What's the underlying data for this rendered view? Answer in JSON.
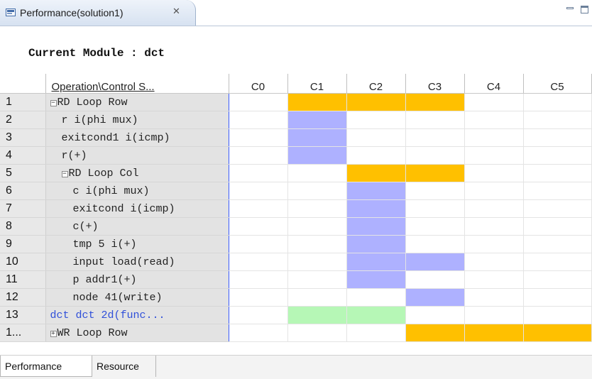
{
  "editor_tab": {
    "title": "Performance(solution1)",
    "close_glyph": "✕",
    "icon": "performance-view-icon"
  },
  "window_controls": {
    "minimize": "minimize-icon",
    "maximize": "maximize-icon"
  },
  "module_heading": "Current Module : dct",
  "table": {
    "headers": {
      "operation": "Operation\\Control S...",
      "steps": [
        "C0",
        "C1",
        "C2",
        "C3",
        "C4",
        "C5"
      ]
    },
    "rows": [
      {
        "num": "1",
        "label": "RD Loop Row",
        "indent": 0,
        "expander": "minus",
        "call": false,
        "cells": [
          "",
          "orange",
          "orange",
          "orange",
          "",
          ""
        ]
      },
      {
        "num": "2",
        "label": "r i(phi mux)",
        "indent": 1,
        "expander": "",
        "call": false,
        "cells": [
          "",
          "blue",
          "",
          "",
          "",
          ""
        ]
      },
      {
        "num": "3",
        "label": "exitcond1 i(icmp)",
        "indent": 1,
        "expander": "",
        "call": false,
        "cells": [
          "",
          "blue",
          "",
          "",
          "",
          ""
        ]
      },
      {
        "num": "4",
        "label": "r(+)",
        "indent": 1,
        "expander": "",
        "call": false,
        "cells": [
          "",
          "blue",
          "",
          "",
          "",
          ""
        ]
      },
      {
        "num": "5",
        "label": "RD Loop Col",
        "indent": 1,
        "expander": "minus",
        "call": false,
        "cells": [
          "",
          "",
          "orange",
          "orange",
          "",
          ""
        ]
      },
      {
        "num": "6",
        "label": "c i(phi mux)",
        "indent": 2,
        "expander": "",
        "call": false,
        "cells": [
          "",
          "",
          "blue",
          "",
          "",
          ""
        ]
      },
      {
        "num": "7",
        "label": "exitcond i(icmp)",
        "indent": 2,
        "expander": "",
        "call": false,
        "cells": [
          "",
          "",
          "blue",
          "",
          "",
          ""
        ]
      },
      {
        "num": "8",
        "label": "c(+)",
        "indent": 2,
        "expander": "",
        "call": false,
        "cells": [
          "",
          "",
          "blue",
          "",
          "",
          ""
        ]
      },
      {
        "num": "9",
        "label": "tmp 5 i(+)",
        "indent": 2,
        "expander": "",
        "call": false,
        "cells": [
          "",
          "",
          "blue",
          "",
          "",
          ""
        ]
      },
      {
        "num": "10",
        "label": "input load(read)",
        "indent": 2,
        "expander": "",
        "call": false,
        "cells": [
          "",
          "",
          "blue",
          "blue",
          "",
          ""
        ]
      },
      {
        "num": "11",
        "label": "p addr1(+)",
        "indent": 2,
        "expander": "",
        "call": false,
        "cells": [
          "",
          "",
          "blue",
          "",
          "",
          ""
        ]
      },
      {
        "num": "12",
        "label": "node 41(write)",
        "indent": 2,
        "expander": "",
        "call": false,
        "cells": [
          "",
          "",
          "",
          "blue",
          "",
          ""
        ]
      },
      {
        "num": "13",
        "label": "dct dct 2d(func...",
        "indent": 0,
        "expander": "",
        "call": true,
        "cells": [
          "",
          "green",
          "green",
          "",
          "",
          ""
        ]
      },
      {
        "num": "1...",
        "label": "WR Loop Row",
        "indent": 0,
        "expander": "plus",
        "call": false,
        "cells": [
          "",
          "",
          "",
          "orange",
          "orange",
          "orange"
        ]
      }
    ]
  },
  "bottom_tabs": [
    {
      "label": "Performance",
      "active": true
    },
    {
      "label": "Resource",
      "active": false
    }
  ],
  "colors": {
    "orange": "#ffc000",
    "blue": "#aeb1ff",
    "green": "#b6f7b6",
    "call_text": "#2f4fd9"
  }
}
